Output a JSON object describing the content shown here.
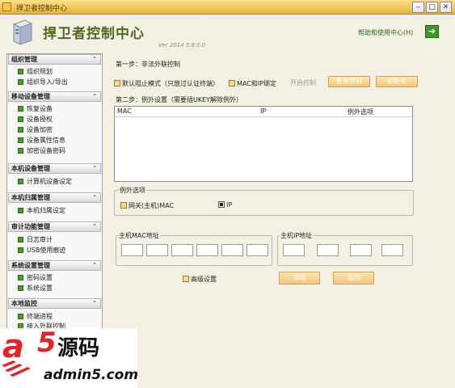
{
  "window": {
    "title": "捍卫者控制中心"
  },
  "header": {
    "app_title": "捍卫者控制中心",
    "version": "Ver 2014 5.8.0.0",
    "help_label": "帮助和使用中心(H)"
  },
  "sidebar": {
    "sections": [
      {
        "title": "组织管理",
        "items": [
          "组织规划",
          "组织导入/导出"
        ]
      },
      {
        "title": "移动设备管理",
        "items": [
          "恢复设备",
          "设备授权",
          "设备加密",
          "设备属性信息",
          "加密设备密码"
        ]
      },
      {
        "title": "本机设备管理",
        "items": [
          "计算机设备设定"
        ]
      },
      {
        "title": "本机归属管理",
        "items": [
          "本机归属设定"
        ]
      },
      {
        "title": "审计功能管理",
        "items": [
          "日志审计",
          "USB使用痕迹"
        ]
      },
      {
        "title": "系统设置管理",
        "items": [
          "密码设置",
          "系统设置"
        ]
      },
      {
        "title": "本地监控",
        "items": [
          "终端进程",
          "接入外联控制"
        ]
      }
    ]
  },
  "step1": {
    "label": "第一步：非法外联控制",
    "default_block": "默认阻止模式（只放过认证终端）",
    "mac_ip_bind": "MAC和IP绑定",
    "start_control": "开启控制",
    "stop_control": "暂停控制",
    "initialize": "初始化"
  },
  "step2": {
    "label": "第二步：例外设置（需要插UKEY解除例外）",
    "columns": [
      "MAC",
      "IP",
      "例外选项"
    ]
  },
  "exception_options": {
    "title": "例外选项",
    "gateway_mac": "网关(主机)MAC",
    "ip": "IP"
  },
  "host_mac": {
    "title": "主机MAC地址"
  },
  "host_ip": {
    "title": "主机IP地址"
  },
  "advanced": "高级设置",
  "add_button": "添加",
  "back_button": "返回",
  "watermark": {
    "logo_a": "a",
    "logo_5": "5",
    "logo_cn": "源码",
    "url": "admin5.com"
  }
}
